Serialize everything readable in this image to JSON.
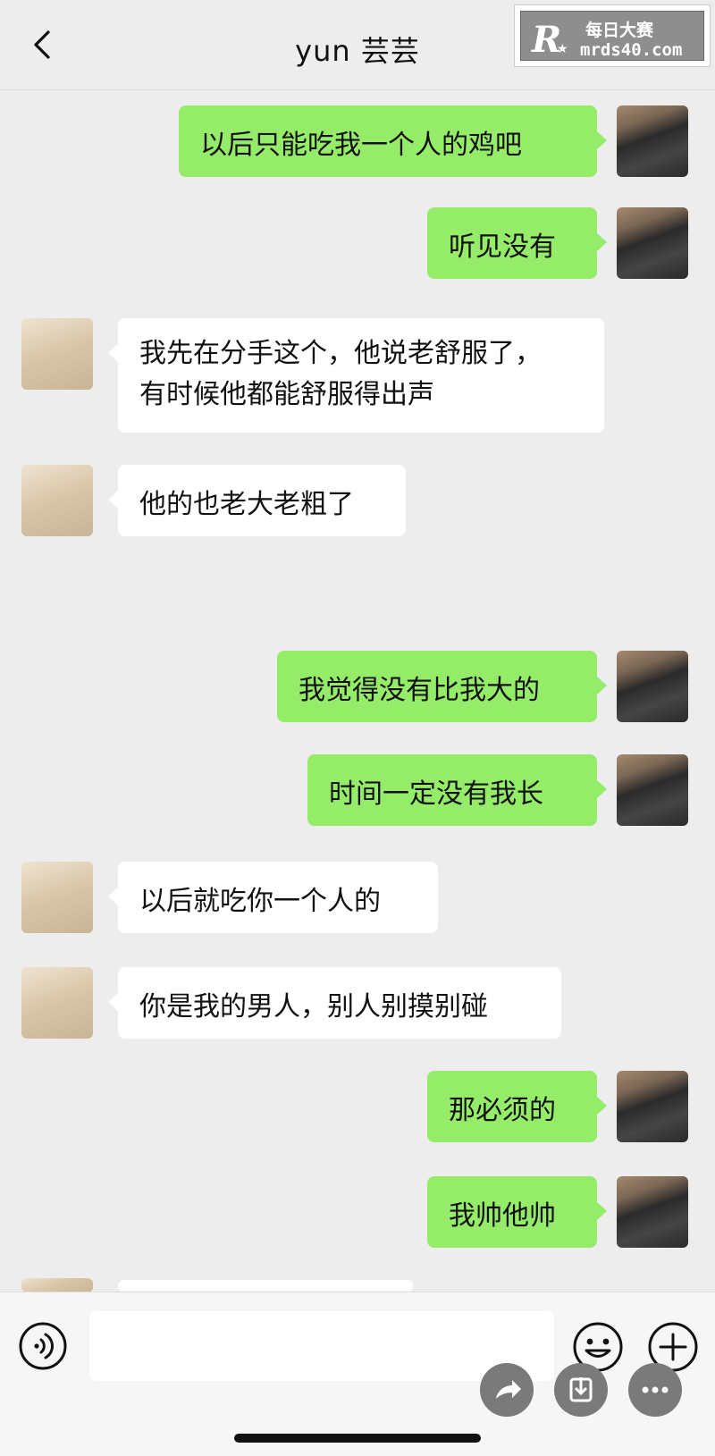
{
  "header": {
    "title": "yun 芸芸"
  },
  "watermark": {
    "text_cn": "每日大赛",
    "url": "mrds40.com"
  },
  "messages": [
    {
      "from": "me",
      "text": "以后只能吃我一个人的鸡吧"
    },
    {
      "from": "me",
      "text": "听见没有"
    },
    {
      "from": "her",
      "lines": [
        "我先在分手这个，他说老舒服了，",
        "有时候他都能舒服得出声"
      ]
    },
    {
      "from": "her",
      "text": "他的也老大老粗了"
    },
    {
      "from": "me",
      "text": "我觉得没有比我大的"
    },
    {
      "from": "me",
      "text": "时间一定没有我长"
    },
    {
      "from": "her",
      "text": "以后就吃你一个人的"
    },
    {
      "from": "her",
      "text": "你是我的男人，别人别摸别碰"
    },
    {
      "from": "me",
      "text": "那必须的"
    },
    {
      "from": "me",
      "text": "我帅他帅"
    }
  ],
  "input": {
    "value": "",
    "placeholder": ""
  },
  "icons": {
    "back": "chevron-left-icon",
    "voice": "voice-icon",
    "emoji": "smiley-icon",
    "plus": "plus-icon",
    "share": "share-icon",
    "save": "download-icon",
    "more": "more-icon"
  },
  "colors": {
    "me_bubble": "#95ec69",
    "her_bubble": "#ffffff",
    "background": "#ededed"
  }
}
